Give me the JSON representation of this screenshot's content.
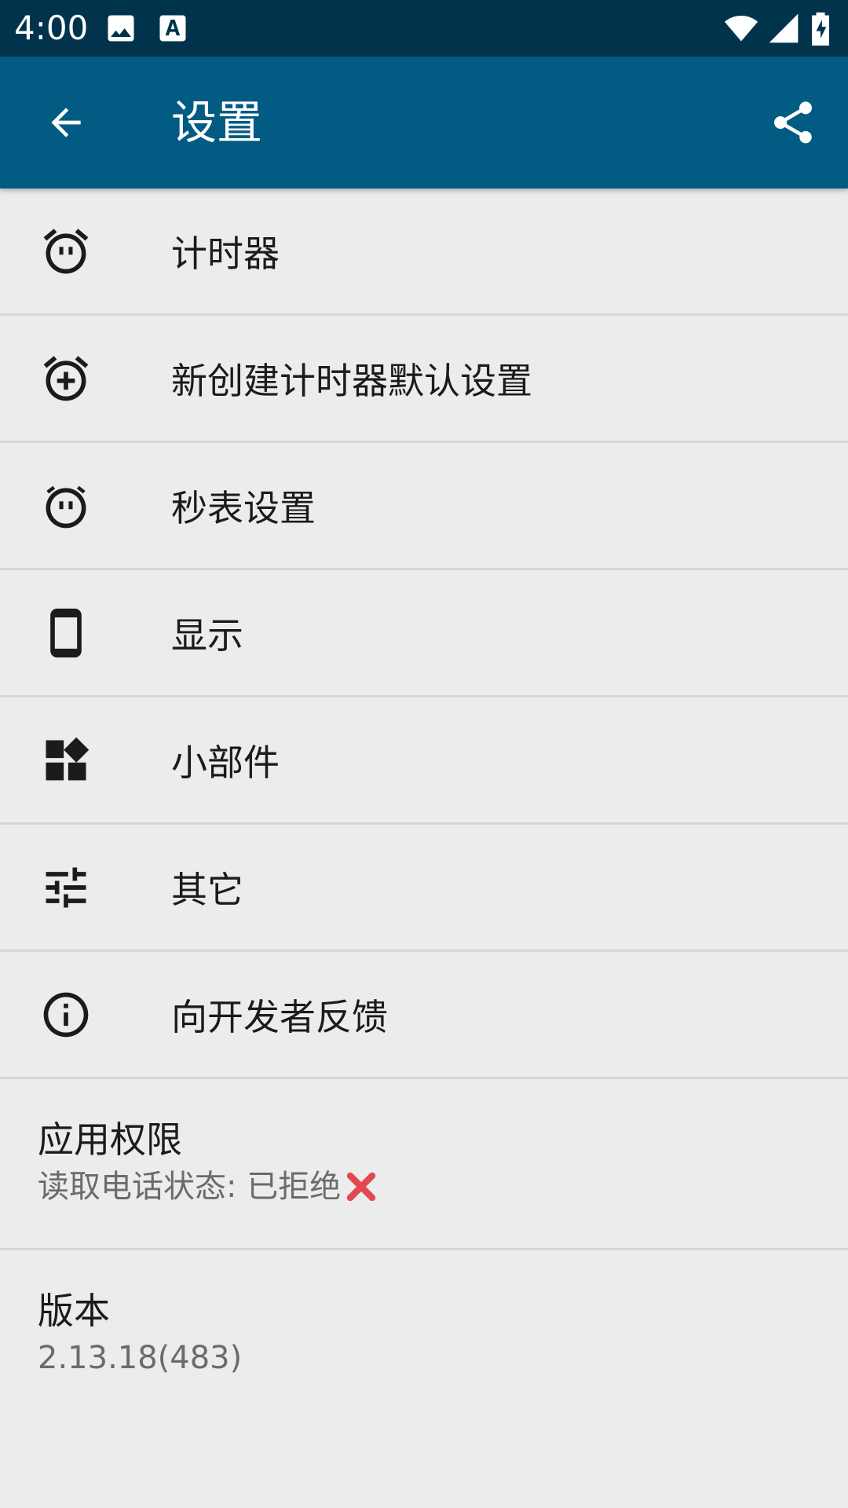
{
  "status_bar": {
    "time": "4:00",
    "icons": [
      "image-icon",
      "text-icon",
      "wifi-icon",
      "signal-icon",
      "battery-charging-icon"
    ]
  },
  "app_bar": {
    "title": "设置",
    "color": "#025b82"
  },
  "menu": [
    {
      "label": "计时器",
      "icon": "alarm-icon"
    },
    {
      "label": "新创建计时器默认设置",
      "icon": "alarm-add-icon"
    },
    {
      "label": "秒表设置",
      "icon": "stopwatch-icon"
    },
    {
      "label": "显示",
      "icon": "phone-icon"
    },
    {
      "label": "小部件",
      "icon": "widgets-icon"
    },
    {
      "label": "其它",
      "icon": "tune-icon"
    },
    {
      "label": "向开发者反馈",
      "icon": "info-icon"
    }
  ],
  "permissions": {
    "title": "应用权限",
    "value": "读取电话状态: 已拒绝"
  },
  "version": {
    "title": "版本",
    "value": "2.13.18(483)"
  }
}
